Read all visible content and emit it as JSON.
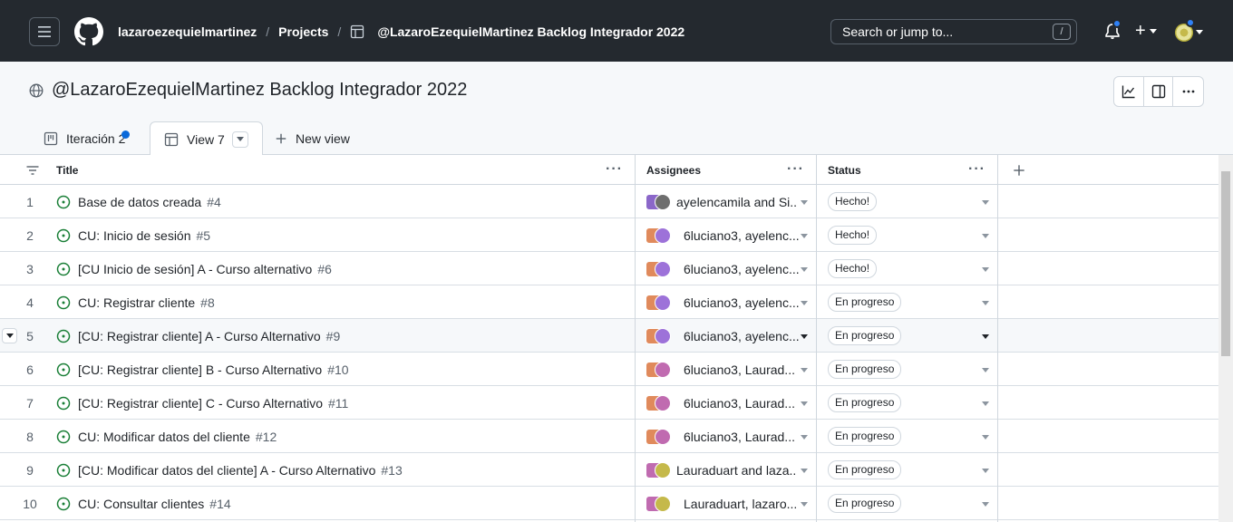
{
  "header": {
    "user": "lazaroezequielmartinez",
    "section": "Projects",
    "project": "@LazaroEzequielMartinez Backlog Integrador 2022",
    "search_placeholder": "Search or jump to...",
    "search_key": "/"
  },
  "project": {
    "title": "@LazaroEzequielMartinez Backlog Integrador 2022"
  },
  "tabs": [
    {
      "label": "Iteración 2",
      "icon": "board-icon",
      "active": false
    },
    {
      "label": "View 7",
      "icon": "table-icon",
      "active": true
    },
    {
      "label": "New view",
      "icon": "plus-icon",
      "active": false
    }
  ],
  "columns": {
    "title": "Title",
    "assignees": "Assignees",
    "status": "Status"
  },
  "rows": [
    {
      "n": "1",
      "title": "Base de datos creada",
      "issue": "#4",
      "assignees": "ayelencamila and Si...",
      "status": "Hecho!"
    },
    {
      "n": "2",
      "title": "CU: Inicio de sesión",
      "issue": "#5",
      "assignees": "6luciano3, ayelenc...",
      "status": "Hecho!"
    },
    {
      "n": "3",
      "title": "[CU Inicio de sesión] A - Curso alternativo",
      "issue": "#6",
      "assignees": "6luciano3, ayelenc...",
      "status": "Hecho!"
    },
    {
      "n": "4",
      "title": "CU: Registrar cliente",
      "issue": "#8",
      "assignees": "6luciano3, ayelenc...",
      "status": "En progreso"
    },
    {
      "n": "5",
      "title": "[CU: Registrar cliente] A - Curso Alternativo",
      "issue": "#9",
      "assignees": "6luciano3, ayelenc...",
      "status": "En progreso"
    },
    {
      "n": "6",
      "title": "[CU: Registrar cliente] B - Curso Alternativo",
      "issue": "#10",
      "assignees": "6luciano3, Laurad...",
      "status": "En progreso"
    },
    {
      "n": "7",
      "title": "[CU: Registrar cliente] C - Curso Alternativo",
      "issue": "#11",
      "assignees": "6luciano3, Laurad...",
      "status": "En progreso"
    },
    {
      "n": "8",
      "title": "CU: Modificar datos del cliente",
      "issue": "#12",
      "assignees": "6luciano3, Laurad...",
      "status": "En progreso"
    },
    {
      "n": "9",
      "title": "[CU: Modificar datos del cliente] A - Curso Alternativo",
      "issue": "#13",
      "assignees": "Lauraduart and laza...",
      "status": "En progreso"
    },
    {
      "n": "10",
      "title": "CU: Consultar clientes",
      "issue": "#14",
      "assignees": "Lauraduart, lazaro...",
      "status": "En progreso"
    }
  ],
  "colors": {
    "header_bg": "#24292f",
    "open_issue": "#1a7f37",
    "notification_dot": "#2f81f7"
  }
}
